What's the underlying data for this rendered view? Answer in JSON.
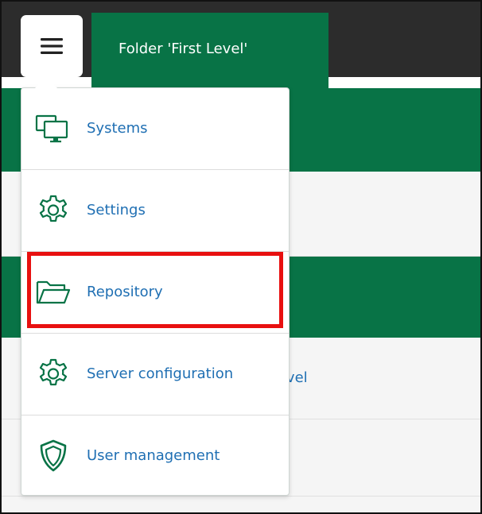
{
  "header": {
    "tab_title": "Folder 'First Level'"
  },
  "menu": {
    "button_icon": "hamburger-icon",
    "items": [
      {
        "label": "Systems",
        "icon": "monitors-icon"
      },
      {
        "label": "Settings",
        "icon": "gear-icon"
      },
      {
        "label": "Repository",
        "icon": "folder-icon"
      },
      {
        "label": "Server configuration",
        "icon": "gear-icon"
      },
      {
        "label": "User management",
        "icon": "shield-icon"
      }
    ]
  },
  "background": {
    "partial_label": "d Level"
  },
  "colors": {
    "brand_green": "#087346",
    "topbar_dark": "#2c2c2c",
    "link_blue": "#1f6fb3",
    "highlight_red": "#e81010"
  }
}
